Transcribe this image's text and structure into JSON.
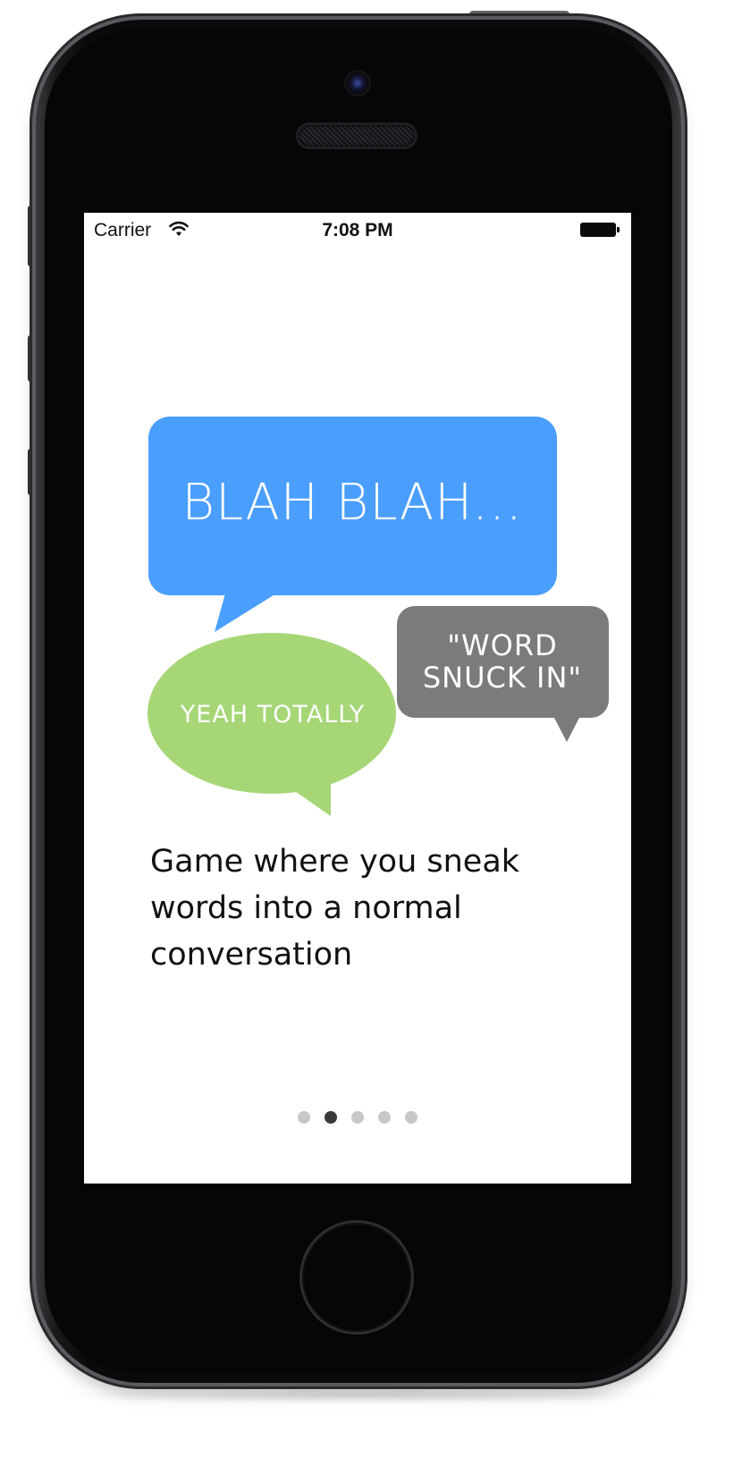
{
  "status_bar": {
    "carrier": "Carrier",
    "time": "7:08 PM"
  },
  "illustration": {
    "blue_bubble_text": "BLAH BLAH...",
    "green_bubble_text": "YEAH TOTALLY",
    "grey_bubble_text": "\"WORD SNUCK IN\"",
    "colors": {
      "blue": "#4a9efd",
      "green": "#a6d676",
      "grey": "#7b7b7b"
    }
  },
  "description": "Game where you sneak words into a normal conversation",
  "pager": {
    "total_pages": 5,
    "current_page": 2
  }
}
